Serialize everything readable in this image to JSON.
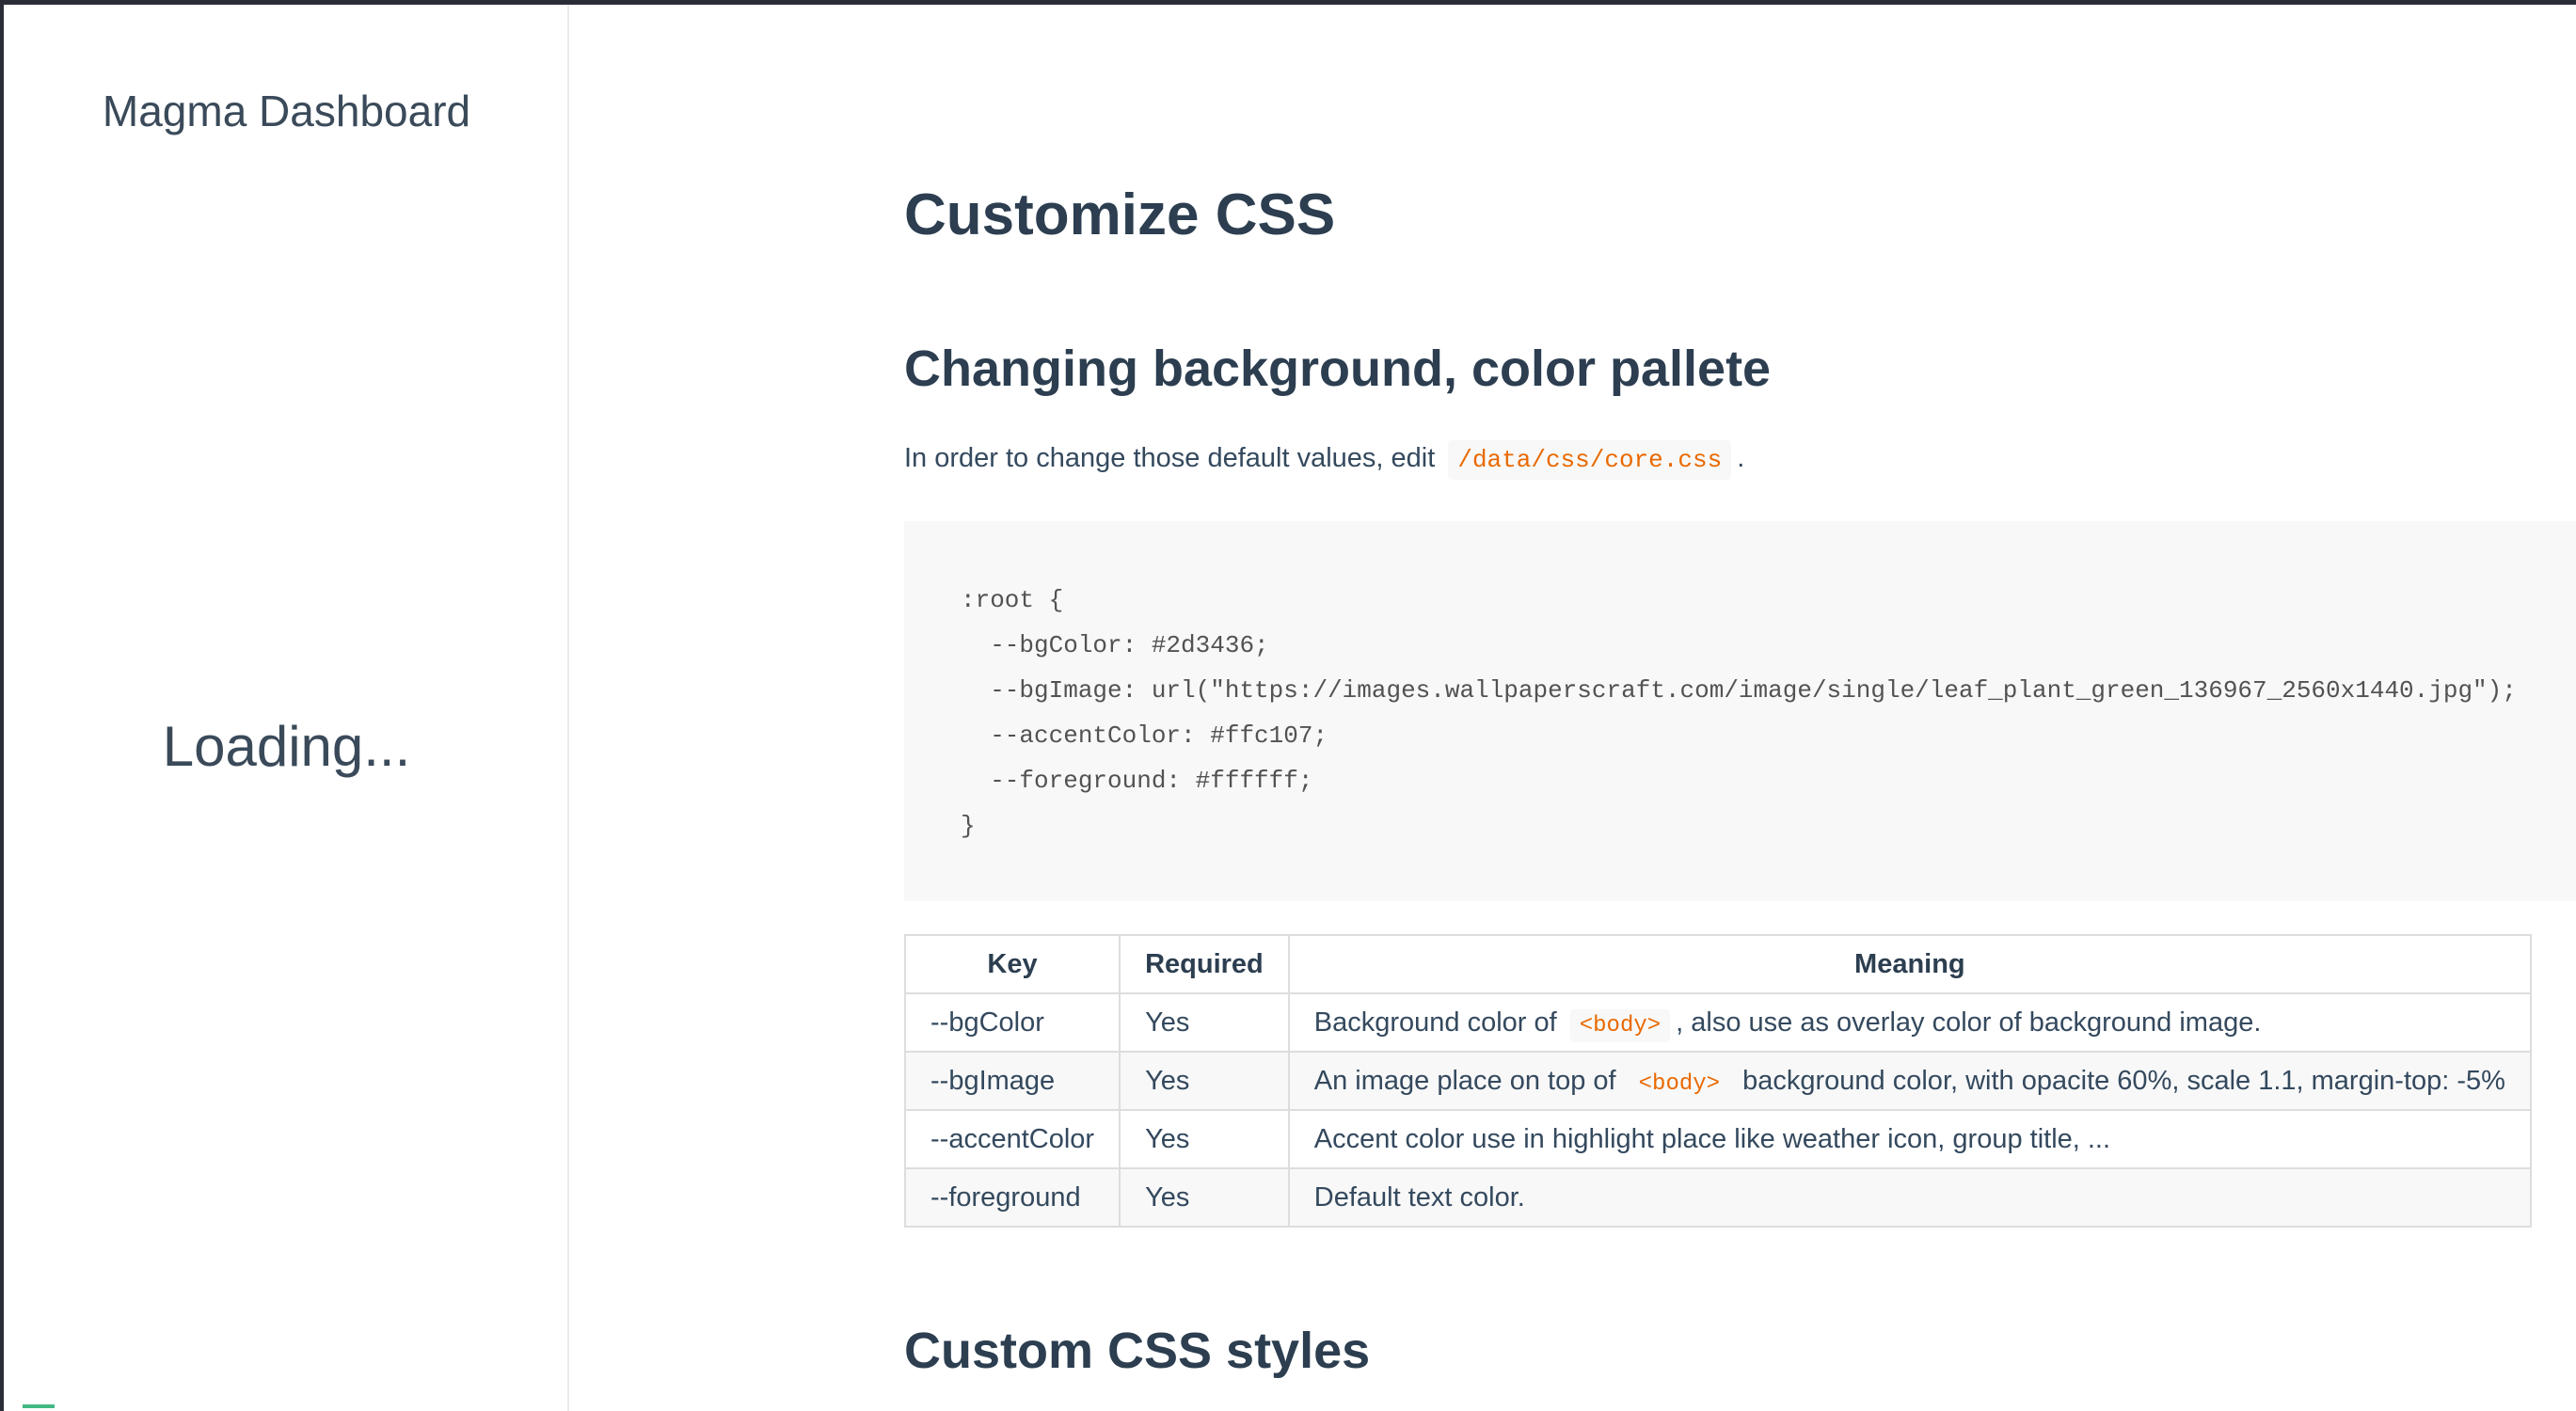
{
  "sidebar": {
    "app_name": "Magma Dashboard",
    "loading_text": "Loading..."
  },
  "content": {
    "page_title": "Customize CSS",
    "section1": {
      "heading": "Changing background, color pallete",
      "intro_before": "In order to change those default values, edit",
      "intro_code": "/data/css/core.css",
      "intro_after": "."
    },
    "code_block": ":root {\n  --bgColor: #2d3436;\n  --bgImage: url(\"https://images.wallpaperscraft.com/image/single/leaf_plant_green_136967_2560x1440.jpg\");\n  --accentColor: #ffc107;\n  --foreground: #ffffff;\n}",
    "table": {
      "headers": [
        "Key",
        "Required",
        "Meaning"
      ],
      "rows": [
        {
          "key": "--bgColor",
          "required": "Yes",
          "meaning_before": "Background color of",
          "meaning_code": "<body>",
          "meaning_after": ", also use as overlay color of background image."
        },
        {
          "key": "--bgImage",
          "required": "Yes",
          "meaning_before": "An image place on top of",
          "meaning_code": "<body>",
          "meaning_after": "background color, with opacite 60%, scale 1.1, margin-top: -5%"
        },
        {
          "key": "--accentColor",
          "required": "Yes",
          "meaning": "Accent color use in highlight place like weather icon, group title, ..."
        },
        {
          "key": "--foreground",
          "required": "Yes",
          "meaning": "Default text color."
        }
      ]
    },
    "section2": {
      "heading": "Custom CSS styles"
    }
  },
  "colors": {
    "accent": "#42b983",
    "inline_code": "#e96900",
    "heading": "#2c3e50",
    "window_border": "#2a2c38"
  }
}
